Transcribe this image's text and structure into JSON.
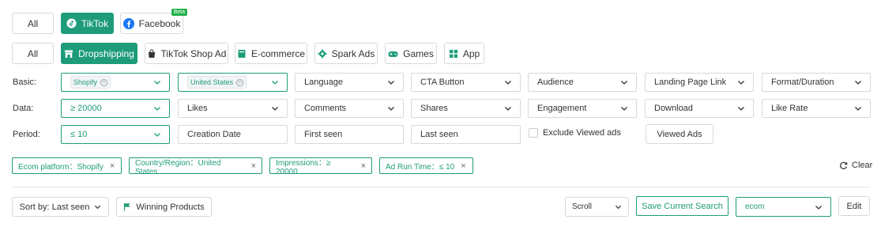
{
  "platform_tabs": [
    {
      "label": "All"
    },
    {
      "label": "TikTok"
    },
    {
      "label": "Facebook",
      "badge": "Beta"
    }
  ],
  "category_tabs": [
    {
      "label": "All"
    },
    {
      "label": "Dropshipping"
    },
    {
      "label": "TikTok Shop Ad"
    },
    {
      "label": "E-commerce"
    },
    {
      "label": "Spark Ads"
    },
    {
      "label": "Games"
    },
    {
      "label": "App"
    }
  ],
  "filters": {
    "basic_label": "Basic:",
    "data_label": "Data:",
    "period_label": "Period:",
    "basic": {
      "ecom_tag": "Shopify",
      "country_tag": "United States",
      "language": "Language",
      "cta": "CTA Button",
      "audience": "Audience",
      "landing": "Landing Page Link",
      "format": "Format/Duration"
    },
    "data": {
      "impressions": "≥ 20000",
      "likes": "Likes",
      "comments": "Comments",
      "shares": "Shares",
      "engagement": "Engagement",
      "download": "Download",
      "like_rate": "Like Rate"
    },
    "period": {
      "run_time": "≤ 10",
      "creation_date": "Creation Date",
      "first_seen": "First seen",
      "last_seen": "Last seen",
      "exclude_viewed": "Exclude Viewed ads",
      "viewed_ads": "Viewed Ads"
    }
  },
  "active_tags": [
    {
      "text": "Ecom platform：Shopify"
    },
    {
      "text": "Country/Region：United States"
    },
    {
      "text": "Impressions：≥ 20000"
    },
    {
      "text": "Ad Run Time：≤ 10"
    }
  ],
  "clear_label": "Clear",
  "bottom": {
    "sort_label": "Sort by: Last seen",
    "winning_label": "Winning Products",
    "scroll_value": "Scroll",
    "save_label": "Save Current Search",
    "search_value": "ecom",
    "edit_label": "Edit"
  },
  "colors": {
    "accent": "#1e9c7a",
    "facebook": "#1877f2",
    "beta": "#22b04a"
  }
}
